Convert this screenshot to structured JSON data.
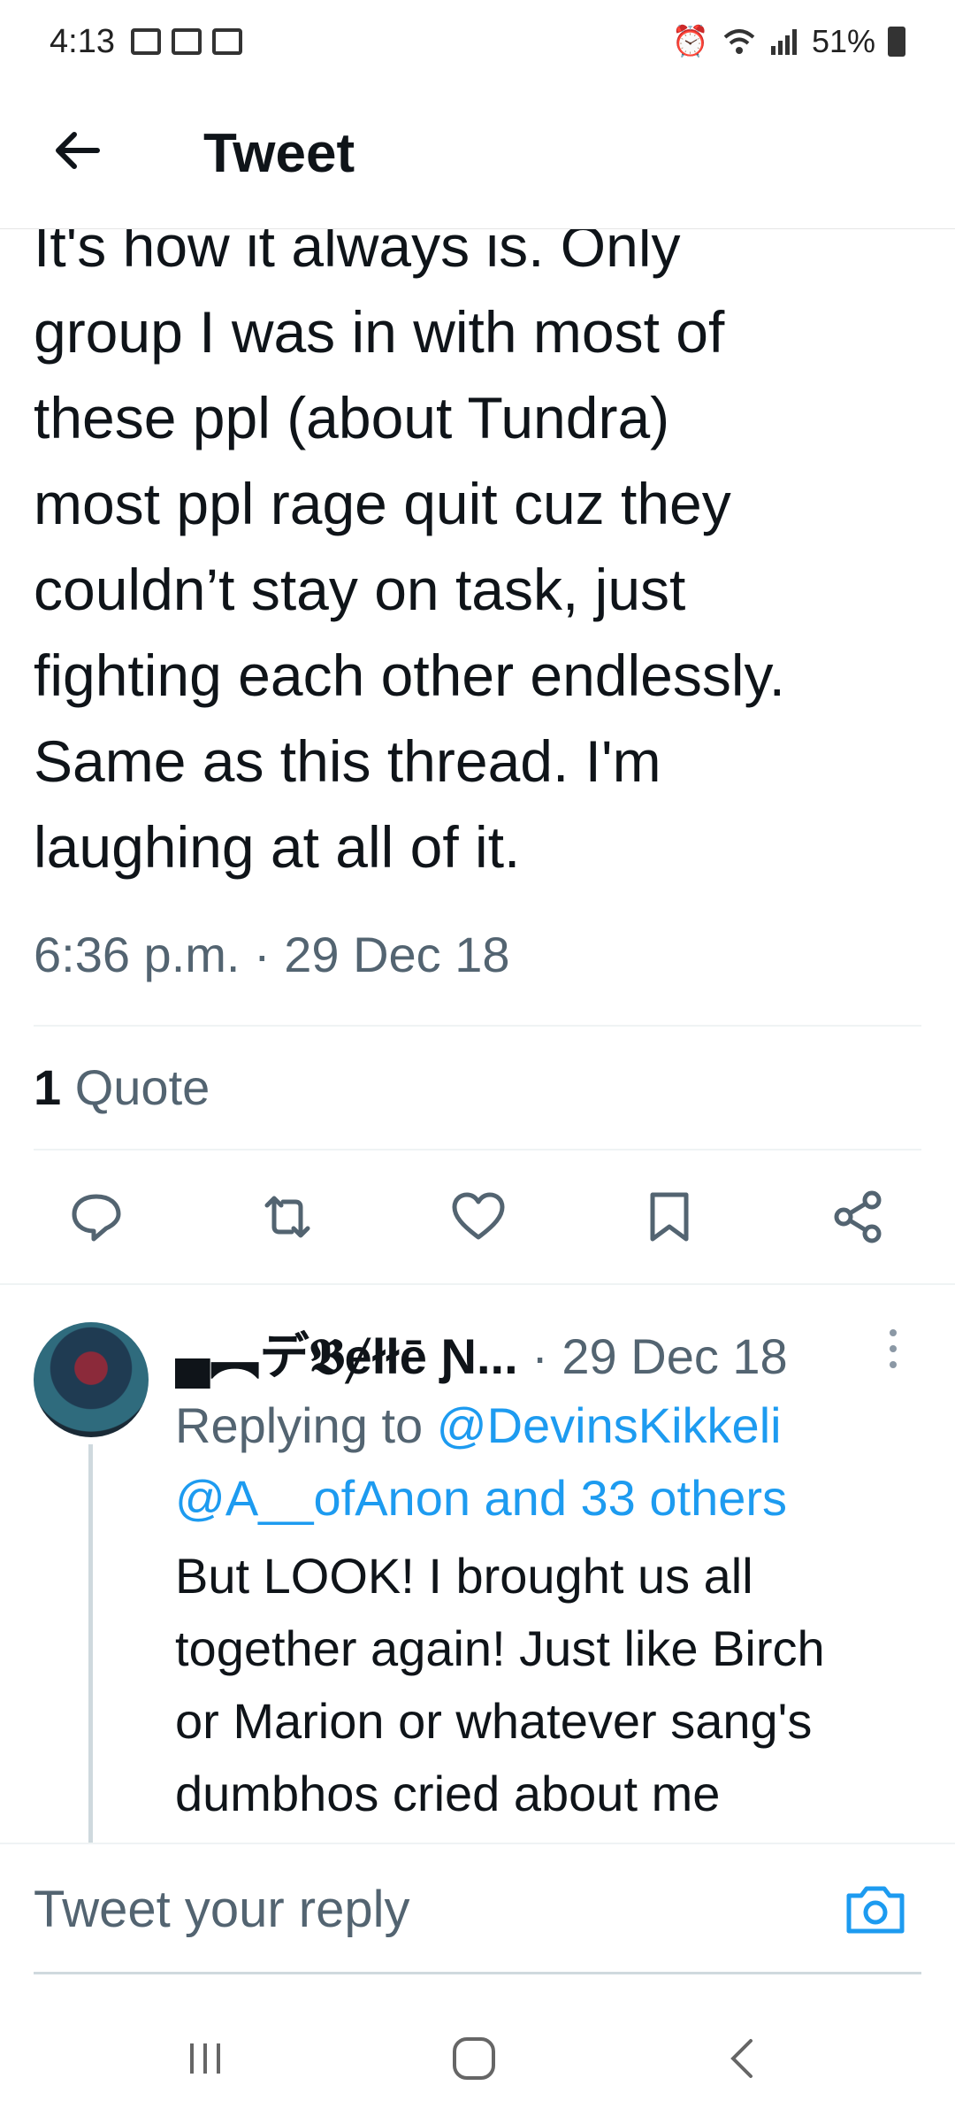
{
  "status_bar": {
    "time": "4:13",
    "battery": "51%",
    "left_icons": [
      "image-icon",
      "calendar-icon",
      "voicemail-icon"
    ],
    "right_icons": [
      "alarm-icon",
      "wifi-icon",
      "signal-icon",
      "battery-icon"
    ]
  },
  "header": {
    "title": "Tweet",
    "back_icon": "arrow-left-icon"
  },
  "tweet": {
    "text": "It's how it always is. Only\ngroup I was in with most of\nthese ppl (about Tundra)\nmost ppl rage quit cuz they\ncouldn’t stay on task, just\nfighting each other endlessly.\nSame as this thread. I'm\nlaughing at all of it.",
    "timestamp": "6:36 p.m. · 29 Dec 18",
    "quote_count": "1",
    "quote_label": "Quote"
  },
  "actions": [
    {
      "name": "reply-icon"
    },
    {
      "name": "retweet-icon"
    },
    {
      "name": "like-icon"
    },
    {
      "name": "bookmark-icon"
    },
    {
      "name": "share-icon"
    }
  ],
  "reply": {
    "author": "▄︻デ𝕭ɇłłē Ɲ...",
    "meta": " · 29 Dec 18",
    "replying_prefix": "Replying to ",
    "mention_1": "@DevinsKikkeli",
    "mention_2": "@A__ofAnon and 33 others",
    "text": "But LOOK! I brought us all\ntogether again! Just like Birch\nor Marion or whatever sang's\ndumbhos cried about me"
  },
  "composer": {
    "placeholder": "Tweet your reply",
    "camera_icon": "camera-icon"
  },
  "colors": {
    "accent": "#1d9bf0",
    "secondary_text": "#536471",
    "primary_text": "#0f1419"
  }
}
